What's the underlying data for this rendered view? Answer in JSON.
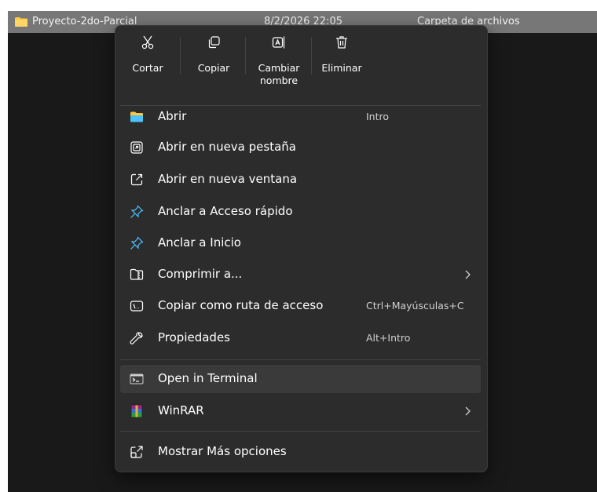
{
  "file_row": {
    "name": "Proyecto-2do-Parcial",
    "date": "8/2/2026 22:05",
    "type": "Carpeta de archivos"
  },
  "quick_actions": [
    {
      "label": "Cortar",
      "icon": "scissors-icon"
    },
    {
      "label": "Copiar",
      "icon": "copy-icon"
    },
    {
      "label": "Cambiar\nnombre",
      "icon": "rename-icon"
    },
    {
      "label": "Eliminar",
      "icon": "trash-icon"
    }
  ],
  "menu_items": [
    {
      "label": "Abrir",
      "shortcut": "Intro",
      "icon": "folder-icon"
    },
    {
      "label": "Abrir en nueva pestaña",
      "icon": "new-tab-icon"
    },
    {
      "label": "Abrir en nueva ventana",
      "icon": "new-window-icon"
    },
    {
      "label": "Anclar a Acceso rápido",
      "icon": "pin-icon"
    },
    {
      "label": "Anclar a Inicio",
      "icon": "pin-icon"
    },
    {
      "label": "Comprimir a...",
      "icon": "zip-folder-icon",
      "submenu": true
    },
    {
      "label": "Copiar como ruta de acceso",
      "shortcut": "Ctrl+Mayúsculas+C",
      "icon": "path-icon"
    },
    {
      "label": "Propiedades",
      "shortcut": "Alt+Intro",
      "icon": "wrench-icon"
    },
    {
      "label": "Open in Terminal",
      "icon": "terminal-icon"
    },
    {
      "label": "WinRAR",
      "icon": "winrar-icon",
      "submenu": true
    },
    {
      "label": "Mostrar Más opciones",
      "icon": "more-options-icon"
    }
  ],
  "colors": {
    "menu_bg": "#2c2c2c",
    "hover_bg": "#3a3a3a",
    "accent_blue": "#4cc2ff",
    "folder_yellow": "#ffc83d"
  }
}
